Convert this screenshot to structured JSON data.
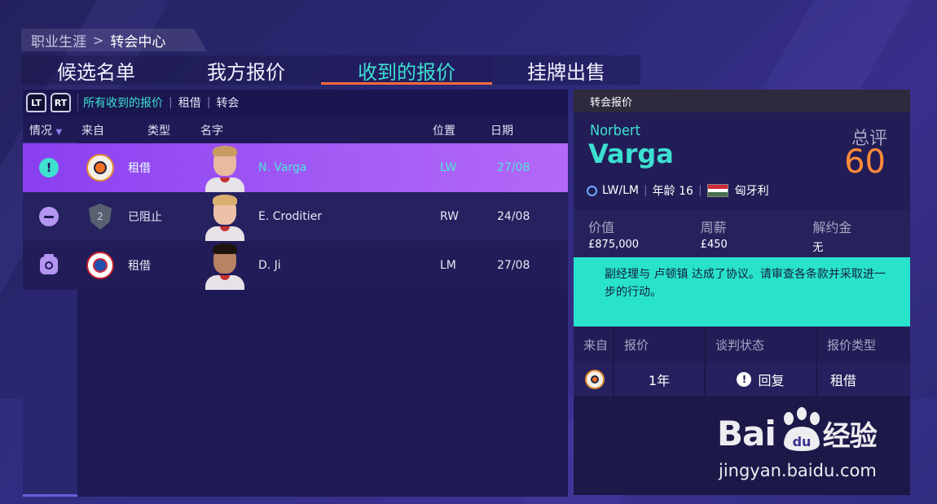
{
  "breadcrumb": {
    "parent": "职业生涯",
    "separator": ">",
    "current": "转会中心"
  },
  "tabs": [
    {
      "label": "候选名单",
      "active": false
    },
    {
      "label": "我方报价",
      "active": false
    },
    {
      "label": "收到的报价",
      "active": true
    },
    {
      "label": "挂牌出售",
      "active": false
    }
  ],
  "filter": {
    "lt": "LT",
    "rt": "RT",
    "items": [
      {
        "label": "所有收到的报价",
        "active": true
      },
      {
        "label": "租借",
        "active": false
      },
      {
        "label": "转会",
        "active": false
      }
    ]
  },
  "columns": {
    "status": "情况",
    "from": "来自",
    "type": "类型",
    "name": "名字",
    "position": "位置",
    "date": "日期"
  },
  "offers": [
    {
      "status_icon": "alert-icon",
      "club_crest": "luton-crest",
      "type": "租借",
      "name": "N. Varga",
      "position": "LW",
      "date": "27/08"
    },
    {
      "status_icon": "blocked-icon",
      "club_crest": "shield-crest",
      "club_badge_text": "2",
      "type": "已阻止",
      "name": "E. Croditier",
      "position": "RW",
      "date": "24/08"
    },
    {
      "status_icon": "timer-icon",
      "club_crest": "club-crest",
      "type": "租借",
      "name": "D. Ji",
      "position": "LM",
      "date": "27/08"
    }
  ],
  "detail": {
    "header": "转会报价",
    "first_name": "Norbert",
    "last_name": "Varga",
    "overall_label": "总评",
    "overall_value": "60",
    "positions": "LW/LM",
    "age_text": "年龄 16",
    "nation": "匈牙利",
    "stats": [
      {
        "label": "价值",
        "value": "£875,000"
      },
      {
        "label": "周薪",
        "value": "£450"
      },
      {
        "label": "解约金",
        "value": "无"
      }
    ],
    "message": "副经理与 卢顿镇 达成了协议。请审查各条款并采取进一步的行动。",
    "table_headers": {
      "from": "来自",
      "offer": "报价",
      "negotiation": "谈判状态",
      "offer_type": "报价类型"
    },
    "table_row": {
      "offer": "1年",
      "negotiation": "回复",
      "offer_type": "租借"
    }
  },
  "watermark": {
    "logo_left": "Bai",
    "logo_mid": "du",
    "logo_right": "经验",
    "url": "jingyan.baidu.com"
  },
  "colors": {
    "accent_teal": "#3de0d0",
    "selected_purple": "#a45cf5",
    "overall_orange": "#ff8a3a",
    "message_bg": "#28e2cc"
  }
}
